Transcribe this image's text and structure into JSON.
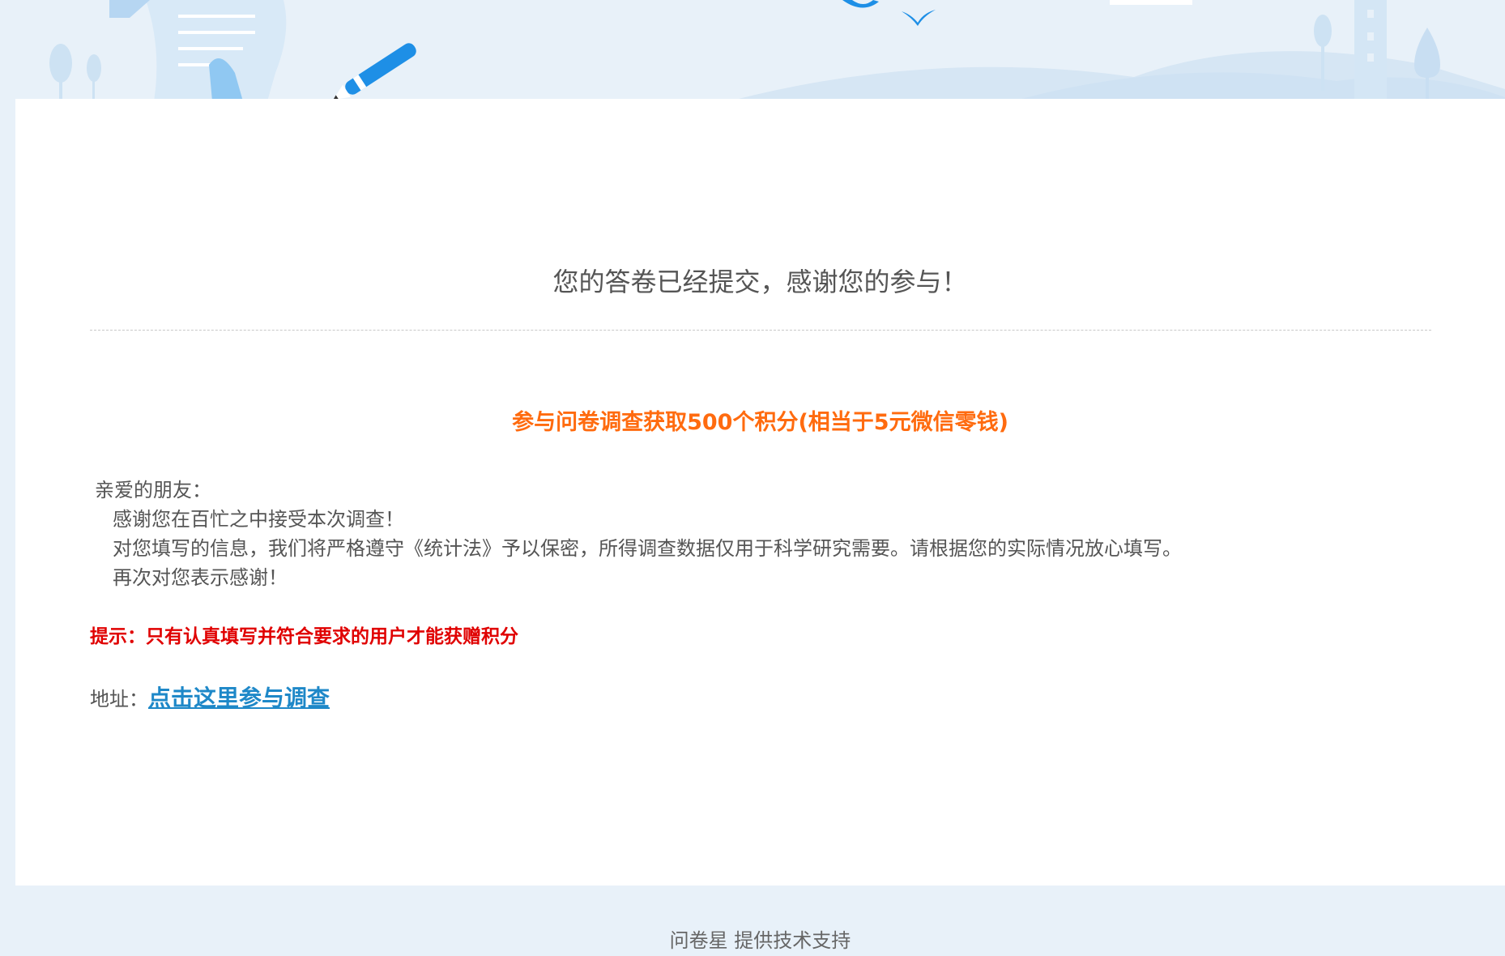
{
  "header": {
    "illustration": "survey-banner-illustration",
    "colors": {
      "background": "#e8f1f9",
      "accent": "#2196f3"
    }
  },
  "main": {
    "title": "您的答卷已经提交，感谢您的参与！",
    "promo": "参与问卷调查获取500个积分(相当于5元微信零钱)",
    "letter": {
      "greeting": "亲爱的朋友：",
      "line1": "感谢您在百忙之中接受本次调查！",
      "line2": "对您填写的信息，我们将严格遵守《统计法》予以保密，所得调查数据仅用于科学研究需要。请根据您的实际情况放心填写。",
      "line3": "再次对您表示感谢！"
    },
    "hint": "提示：只有认真填写并符合要求的用户才能获赠积分",
    "address_label": "地址：",
    "address_link": "点击这里参与调查"
  },
  "footer": {
    "text": "问卷星 提供技术支持"
  },
  "colors": {
    "promo": "#ff6b0f",
    "hint": "#e00000",
    "link": "#1e88c8"
  }
}
